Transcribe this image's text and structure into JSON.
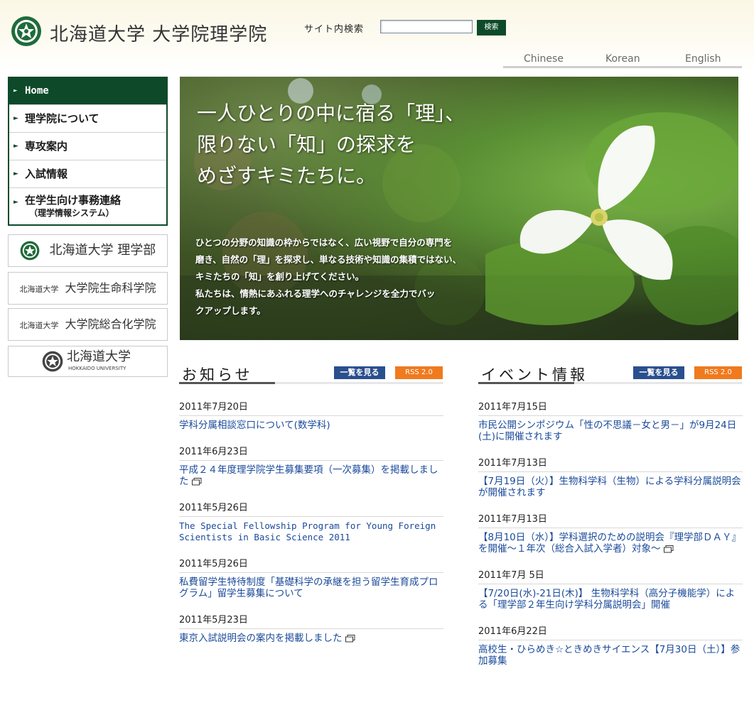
{
  "header": {
    "site_title": "北海道大学 大学院理学院",
    "search_label": "サイト内検索",
    "search_value": "",
    "search_button": "検索",
    "languages": [
      "Chinese",
      "Korean",
      "English"
    ]
  },
  "nav": {
    "items": [
      {
        "label": "Home"
      },
      {
        "label": "理学院について"
      },
      {
        "label": "専攻案内"
      },
      {
        "label": "入試情報"
      },
      {
        "label": "在学生向け事務連絡",
        "sub": "（理学情報システム）"
      }
    ]
  },
  "side_links": {
    "rigakubu": "北海道大学 理学部",
    "seimei_prefix": "北海道大学",
    "seimei": "大学院生命科学院",
    "sougou_prefix": "北海道大学",
    "sougou": "大学院総合化学院",
    "hokudai": "北海道大学",
    "hokudai_en": "HOKKAIDO UNIVERSITY"
  },
  "hero": {
    "heading": "一人ひとりの中に宿る「理」、\n限りない「知」の探求を\nめざすキミたちに。",
    "body": "ひとつの分野の知識の枠からではなく、広い視野で自分の専門を\n磨き、自然の「理」を探求し、単なる技術や知識の集積ではない、\nキミたちの「知」を創り上げてください。\n私たちは、情熱にあふれる理学へのチャレンジを全力でバッ\nクアップします。"
  },
  "news": {
    "title": "お知らせ",
    "list_button": "一覧を見る",
    "rss_button": "RSS 2.0",
    "entries": [
      {
        "date": "2011年7月20日",
        "text": "学科分属相談窓口について(数学科)"
      },
      {
        "date": "2011年6月23日",
        "text": "平成２４年度理学院学生募集要項（一次募集）を掲載しました"
      },
      {
        "date": "2011年5月26日",
        "text": "The Special Fellowship Program for Young Foreign Scientists in Basic Science 2011"
      },
      {
        "date": "2011年5月26日",
        "text": "私費留学生特待制度「基礎科学の承継を担う留学生育成プログラム」留学生募集について"
      },
      {
        "date": "2011年5月23日",
        "text": "東京入試説明会の案内を掲載しました"
      }
    ]
  },
  "events": {
    "title": "イベント情報",
    "list_button": "一覧を見る",
    "rss_button": "RSS 2.0",
    "entries": [
      {
        "date": "2011年7月15日",
        "text": "市民公開シンポジウム「性の不思議－女と男－」が9月24日(土)に開催されます"
      },
      {
        "date": "2011年7月13日",
        "text": "【7月19日（火）】生物科学科（生物）による学科分属説明会が開催されます"
      },
      {
        "date": "2011年7月13日",
        "text": "【8月10日（水）】学科選択のための説明会『理学部ＤＡＹ』を開催～１年次（総合入試入学者）対象～"
      },
      {
        "date": "2011年7月 5日",
        "text": "【7/20日(水)-21日(木)】 生物科学科（高分子機能学）による「理学部２年生向け学科分属説明会」開催"
      },
      {
        "date": "2011年6月22日",
        "text": "高校生・ひらめき☆ときめきサイエンス【7月30日（土）】参加募集"
      }
    ]
  },
  "colors": {
    "brand_green": "#0e4a2a",
    "link_blue": "#1a4a9a",
    "list_button_blue": "#2a4f8e",
    "rss_orange": "#f07a1e"
  }
}
